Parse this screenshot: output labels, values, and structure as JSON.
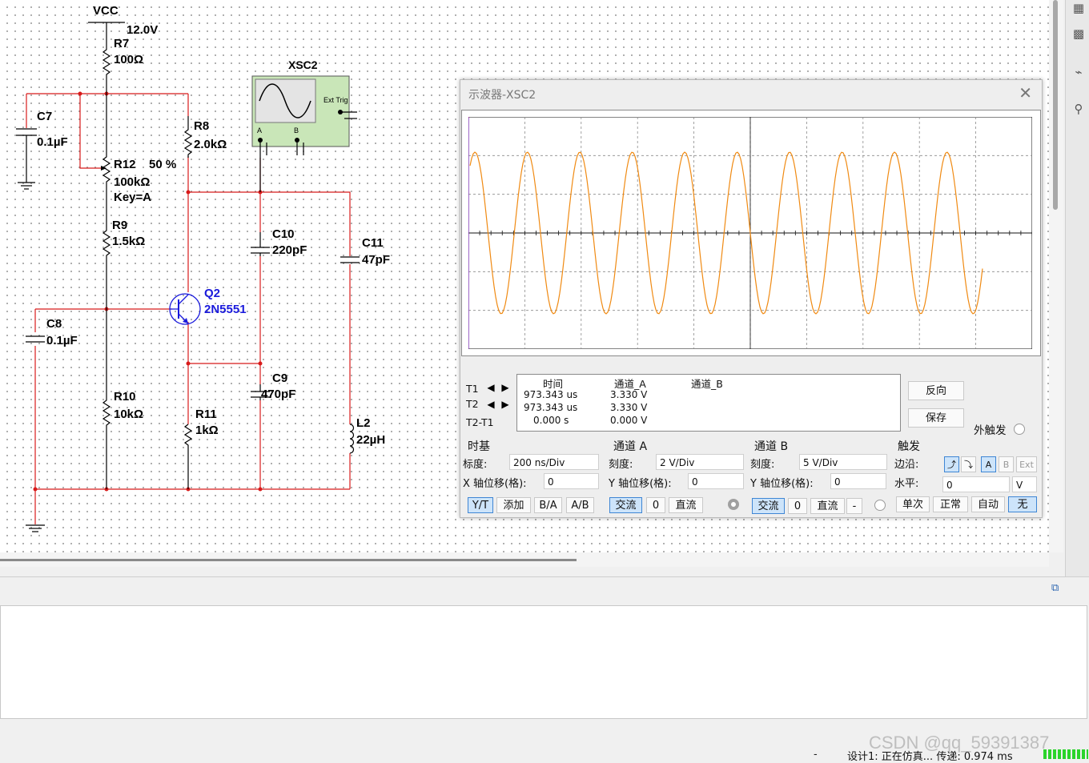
{
  "schematic": {
    "vcc_label": "VCC",
    "vcc_value": "12.0V",
    "scope_name": "XSC2",
    "scope_ext_trig": "Ext Trig",
    "scope_pin_a": "A",
    "scope_pin_b": "B",
    "components": {
      "r7": {
        "ref": "R7",
        "value": "100Ω"
      },
      "c7": {
        "ref": "C7",
        "value": "0.1µF"
      },
      "r8": {
        "ref": "R8",
        "value": "2.0kΩ"
      },
      "r12": {
        "ref": "R12",
        "percent": "50 %",
        "value": "100kΩ",
        "key": "Key=A"
      },
      "r9": {
        "ref": "R9",
        "value": "1.5kΩ"
      },
      "c10": {
        "ref": "C10",
        "value": "220pF"
      },
      "c11": {
        "ref": "C11",
        "value": "47pF"
      },
      "q2": {
        "ref": "Q2",
        "value": "2N5551"
      },
      "c8": {
        "ref": "C8",
        "value": "0.1µF"
      },
      "c9": {
        "ref": "C9",
        "value": "470pF"
      },
      "r10": {
        "ref": "R10",
        "value": "10kΩ"
      },
      "r11": {
        "ref": "R11",
        "value": "1kΩ"
      },
      "l2": {
        "ref": "L2",
        "value": "22µH"
      }
    }
  },
  "scope_window": {
    "title": "示波器-XSC2",
    "close_label": "✕",
    "trace_color": "#f08a12",
    "readout": {
      "col_time": "时间",
      "col_a": "通道_A",
      "col_b": "通道_B",
      "rows": [
        {
          "label": "T1",
          "time": "973.343 us",
          "a": "3.330 V",
          "b": ""
        },
        {
          "label": "T2",
          "time": "973.343 us",
          "a": "3.330 V",
          "b": ""
        },
        {
          "label": "T2-T1",
          "time": "0.000 s",
          "a": "0.000 V",
          "b": ""
        }
      ]
    },
    "reverse_button": "反向",
    "save_button": "保存",
    "ext_trigger_label": "外触发",
    "timebase": {
      "title": "时基",
      "scale_label": "标度:",
      "scale_value": "200 ns/Div",
      "xpos_label": "X 轴位移(格):",
      "xpos_value": "0",
      "buttons": [
        "Y/T",
        "添加",
        "B/A",
        "A/B"
      ]
    },
    "channel_a": {
      "title": "通道 A",
      "scale_label": "刻度:",
      "scale_value": "2  V/Div",
      "ypos_label": "Y 轴位移(格):",
      "ypos_value": "0",
      "ac_label": "交流",
      "zero_label": "0",
      "dc_label": "直流"
    },
    "channel_b": {
      "title": "通道 B",
      "scale_label": "刻度:",
      "scale_value": "5  V/Div",
      "ypos_label": "Y 轴位移(格):",
      "ypos_value": "0",
      "ac_label": "交流",
      "zero_label": "0",
      "dc_label": "直流",
      "minus_label": "-"
    },
    "trigger": {
      "title": "触发",
      "edge_label": "边沿:",
      "level_label": "水平:",
      "level_value": "0",
      "level_unit": "V",
      "src_a": "A",
      "src_b": "B",
      "src_ext": "Ext",
      "modes": [
        "单次",
        "正常",
        "自动",
        "无"
      ]
    }
  },
  "status_bar": {
    "dash": "-",
    "text": "设计1: 正在仿真... 传递: 0.974 ms"
  },
  "watermark": "CSDN @qq_59391387"
}
